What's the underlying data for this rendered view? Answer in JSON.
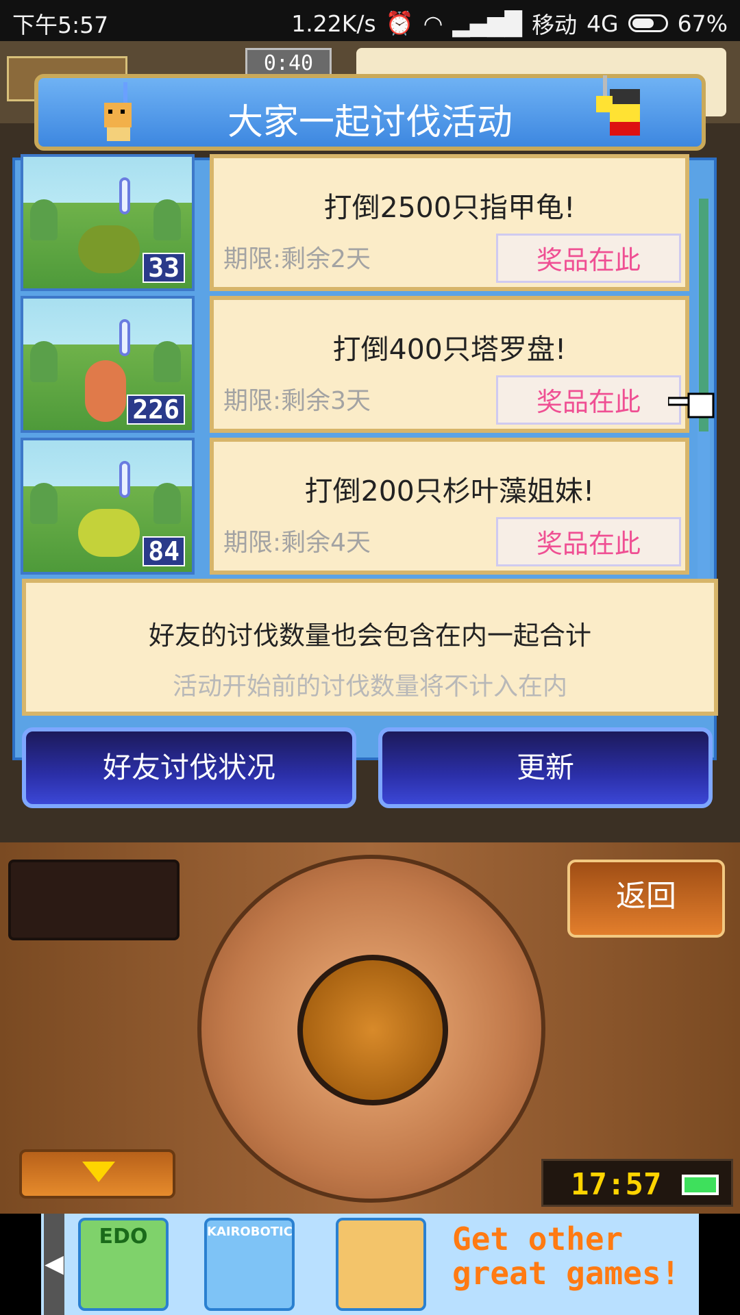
{
  "status_bar": {
    "time": "下午5:57",
    "network_speed": "1.22K/s",
    "carrier": "移动",
    "network_type": "4G",
    "battery": "67%"
  },
  "hud": {
    "timer": "0:40"
  },
  "dialog": {
    "title": "大家一起讨伐活动",
    "quests": [
      {
        "title": "打倒2500只指甲龟!",
        "deadline": "期限:剩余2天",
        "prize_label": "奖品在此",
        "count": "33",
        "monster_color": "#7a9a2a"
      },
      {
        "title": "打倒400只塔罗盘!",
        "deadline": "期限:剩余3天",
        "prize_label": "奖品在此",
        "count": "226",
        "monster_color": "#e07a4a"
      },
      {
        "title": "打倒200只杉叶藻姐妹!",
        "deadline": "期限:剩余4天",
        "prize_label": "奖品在此",
        "count": "84",
        "monster_color": "#c4d23a"
      }
    ],
    "note_line1": "好友的讨伐数量也会包含在内一起合计",
    "note_line2": "活动开始前的讨伐数量将不计入在内",
    "friend_button": "好友讨伐状况",
    "refresh_button": "更新"
  },
  "console": {
    "back_button": "返回",
    "clock": "17:57"
  },
  "ad": {
    "tiles": [
      {
        "label": "EDO"
      },
      {
        "label": "KAIROBOTICA"
      },
      {
        "label": ""
      }
    ],
    "promo_text": "Get other great games!"
  }
}
